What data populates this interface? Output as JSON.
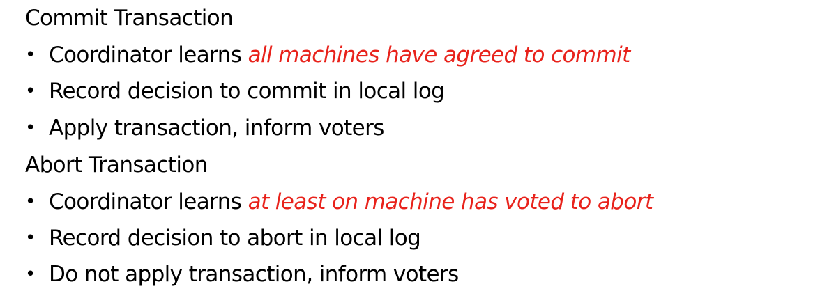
{
  "sections": [
    {
      "title": "Commit Transaction",
      "bullets": [
        {
          "text": "Coordinator learns ",
          "emphasis": "all machines have agreed to commit"
        },
        {
          "text": "Record decision to commit in local log",
          "emphasis": ""
        },
        {
          "text": "Apply transaction, inform voters",
          "emphasis": ""
        }
      ]
    },
    {
      "title": "Abort Transaction",
      "bullets": [
        {
          "text": "Coordinator learns ",
          "emphasis": "at least on machine has voted to abort"
        },
        {
          "text": "Record decision to abort in local log",
          "emphasis": ""
        },
        {
          "text": "Do not apply transaction, inform voters",
          "emphasis": ""
        }
      ]
    }
  ],
  "bullet_symbol": "•",
  "colors": {
    "text": "#000000",
    "emphasis": "#e8221b",
    "background": "#ffffff"
  }
}
